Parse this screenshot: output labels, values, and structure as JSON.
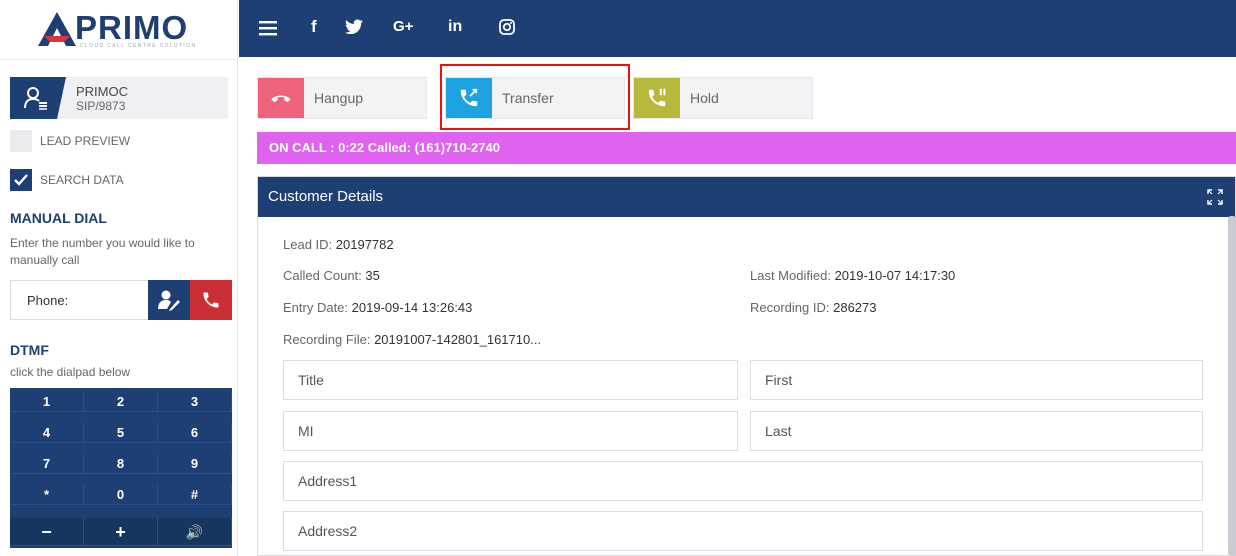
{
  "brand": {
    "logo_text": "PRIMO",
    "tagline": "CLOUD CALL CENTRE SOLUTION"
  },
  "topnav": {
    "icons": [
      "menu-icon",
      "facebook-icon",
      "twitter-icon",
      "google-plus-icon",
      "linkedin-icon",
      "instagram-icon"
    ],
    "facebook": "f",
    "google": "G+",
    "linkedin": "in"
  },
  "agent": {
    "name": "PRIMOC",
    "sip": "SIP/9873"
  },
  "options": {
    "lead_preview": "LEAD PREVIEW",
    "search_data": "SEARCH DATA"
  },
  "manual_dial": {
    "title": "MANUAL DIAL",
    "description": "Enter the number you would like to manually call",
    "phone_placeholder": "Phone:"
  },
  "dtmf": {
    "title": "DTMF",
    "description": "click the dialpad below",
    "keys": [
      "1",
      "2",
      "3",
      "4",
      "5",
      "6",
      "7",
      "8",
      "9",
      "*",
      "0",
      "#"
    ],
    "bottom_keys": [
      "−",
      "+",
      "🔊"
    ]
  },
  "call_controls": {
    "hangup": "Hangup",
    "transfer": "Transfer",
    "hold": "Hold"
  },
  "status": {
    "text": "ON CALL : 0:22 Called: (161)710-2740"
  },
  "customer": {
    "title": "Customer Details",
    "lead_id_label": "Lead ID:",
    "lead_id": "20197782",
    "called_count_label": "Called Count:",
    "called_count": "35",
    "last_modified_label": "Last Modified:",
    "last_modified": "2019-10-07 14:17:30",
    "entry_date_label": "Entry Date:",
    "entry_date": "2019-09-14 13:26:43",
    "recording_id_label": "Recording ID:",
    "recording_id": "286273",
    "recording_file_label": "Recording File:",
    "recording_file": "20191007-142801_161710...",
    "fields": {
      "title": "Title",
      "first": "First",
      "mi": "MI",
      "last": "Last",
      "address1": "Address1",
      "address2": "Address2"
    }
  },
  "colors": {
    "navy": "#1d3f74",
    "hangup": "#f0617a",
    "transfer": "#1fa3e0",
    "hold": "#b5b83a",
    "status": "#e063f0",
    "call": "#cc2e35"
  }
}
